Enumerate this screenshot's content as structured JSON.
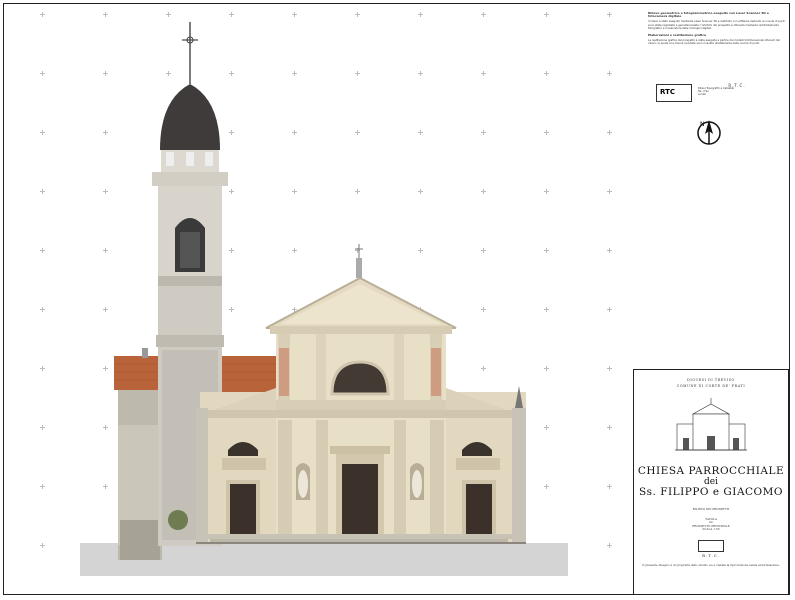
{
  "notes": {
    "heading1": "Rilievo geometrico e fotogrammetrico eseguito con Laser Scanner 3D e fotocamera digitale",
    "paragraph1": "Il rilievo è stato eseguito mediante Laser Scanner 3D e restituito con software dedicati; le nuvole di punti sono state registrate e georeferenziate; l'ortofoto del prospetto è ottenuta mediante raddrizzamento fotografico e mosaicatura delle immagini digitali.",
    "heading2": "Elaborazioni e restituzione grafica",
    "paragraph2": "La restituzione grafica del prospetto è stata eseguita a partire dai modelli tridimensionali ottenuti dal rilievo; le quote e le misure riportate sono ricavate direttamente dalla nuvola di punti."
  },
  "logo": {
    "mark": "RTC",
    "company": "R.T.C.",
    "lines": [
      "Rilievi Topografici e Catastali",
      "Tel. / Fax",
      "e-mail"
    ]
  },
  "compass": {
    "label": "N"
  },
  "title_block": {
    "diocese": "DIOCESI DI TREVISO",
    "municipality": "COMUNE DI CORTE DE' FRATI",
    "title_line1": "CHIESA PARROCCHIALE",
    "title_line2": "dei",
    "title_line3": "Ss. FILIPPO e GIACOMO",
    "drawing_type": "RILIEVO DEI PROSPETTI",
    "table_label": "TAVOLA",
    "table_number": "02",
    "view": "PROSPETTO PRINCIPALE",
    "scale": "SCALA 1:50",
    "company": "R.T.C.",
    "footer": "Il presente disegno è di proprietà dello studio; ne è vietata la riproduzione senza autorizzazione."
  },
  "colors": {
    "roof_tiles": "#b8633a",
    "dome": "#3e3b3a",
    "facade_plaster": "#e6dcc4",
    "stone": "#ccc8bc",
    "ground": "#d4d4d4",
    "door": "#3b302a"
  }
}
